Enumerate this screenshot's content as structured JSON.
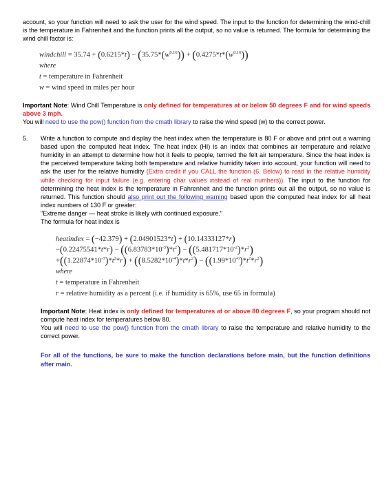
{
  "document": {
    "intro_paragraph": "account, so your function will need to ask the user for the wind speed. The input to the function for determining the wind-chill is the temperature in Fahrenheit and the function prints all the output, so no value is returned. The formula for determining the wind chill factor is:",
    "windchill_formula": {
      "name": "windchill",
      "equals": "=",
      "full_text": "windchill = 35.74 + (0.6215 * t) - (35.75 * (w^0.16)) + (0.4275 * t * (w^0.16))",
      "terms": {
        "constant": "35.74",
        "t_coefficient": "0.6215",
        "w_coefficient": "35.75",
        "tw_coefficient": "0.4275",
        "exponent": "0.16"
      }
    },
    "windchill_where": "where",
    "windchill_definitions": [
      {
        "symbol": "t",
        "equals": "=",
        "meaning": "temperature in Fahrenheit"
      },
      {
        "symbol": "w",
        "equals": "=",
        "meaning": "wind speed in miles per hour"
      }
    ],
    "windchill_note": {
      "label": "Important Note",
      "colon": ": ",
      "lead": "Wind Chill Temperature is ",
      "red_text": "only defined for temperatures at or below 50 degrees F and for wind speeds above 3 mph.",
      "second_lead": "You will ",
      "blue_text": "need to use the pow() function from the cmath library",
      "second_tail": " to raise the wind speed (w) to the correct power."
    },
    "item5": {
      "number": "5.",
      "text_part1": "Write a function to compute and display the heat index when the temperature is 80 F or above and print out a warning based upon the computed heat index.  The heat index (HI) is an index that combines air temperature and relative humidity in an attempt to determine how hot it feels to people, termed the felt air temperature. Since the heat index is the perceived temperature taking both temperature and relative humidity taken into account, your function will need to ask the user for the relative humidity ",
      "red_extra_credit": "(Extra credit if you CALL the function (6. Below) to read in the relative humidity while checking for input failure (e.g. entering char values instead of real numbers))",
      "text_part2": ". The input to the function for determining the heat index is the temperature in Fahrenheit and the function prints out all the output, so no value is returned. This function should ",
      "blue_underline": "also print out the following warning",
      "text_part3": " based upon the computed heat index for all heat index numbers of 130 F or greater:",
      "warning_quote": "\"Extreme danger — heat stroke is likely with continued exposure.\"",
      "formula_intro": "The formula for heat index is"
    },
    "heatindex_formula": {
      "name": "heatindex",
      "equals": "=",
      "full_text": "heatindex = (-42.379) + (2.04901523 * t) + (10.14333127 * r) - (0.22475541 * t * r) - ((6.83783*10^-3) * t^2) - ((5.481717*10^-2) * r^2) + ((1.22874*10^-3) * t^2 * r) + ((8.5282*10^-4) * t * r^2) - ((1.99*10^-6) * t^2 * r^2)",
      "line1": {
        "c0": "42.379",
        "c1": "2.04901523",
        "c2": "10.14333127"
      },
      "line2": {
        "c3": "0.22475541",
        "c4_mantissa": "6.83783",
        "c4_exp": "-3",
        "c5_mantissa": "5.481717",
        "c5_exp": "-2"
      },
      "line3": {
        "c6_mantissa": "1.22874",
        "c6_exp": "-3",
        "c7_mantissa": "8.5282",
        "c7_exp": "-4",
        "c8_mantissa": "1.99",
        "c8_exp": "-6"
      }
    },
    "heatindex_where": "where",
    "heatindex_definitions": [
      {
        "symbol": "t",
        "equals": "=",
        "meaning": "temperature in Fahrenheit"
      },
      {
        "symbol": "r",
        "equals": "=",
        "meaning": "relative humidity as a percent (i.e. if humidity is 65%, use 65 in formula)"
      }
    ],
    "heatindex_note": {
      "label": "Important Note",
      "colon": ": ",
      "lead": "Heat index is ",
      "red_text": "only defined for temperatures at or above 80 degrees F",
      "tail": ", so your program should not compute heat index for temperatures below 80.",
      "second_lead": "You will ",
      "blue_text": "need to use the pow() function from the cmath library",
      "second_tail": " to raise the temperature and relative humidity to the correct power."
    },
    "closing_note": "For all of the functions, be sure to make the function declarations before main, but the function definitions after main."
  },
  "colors": {
    "red": "#ED2024",
    "blue": "#3A35B8",
    "blue_bold": "#3333BB",
    "text": "#000000",
    "math_text": "#2b2b2b",
    "background": "#ffffff"
  }
}
